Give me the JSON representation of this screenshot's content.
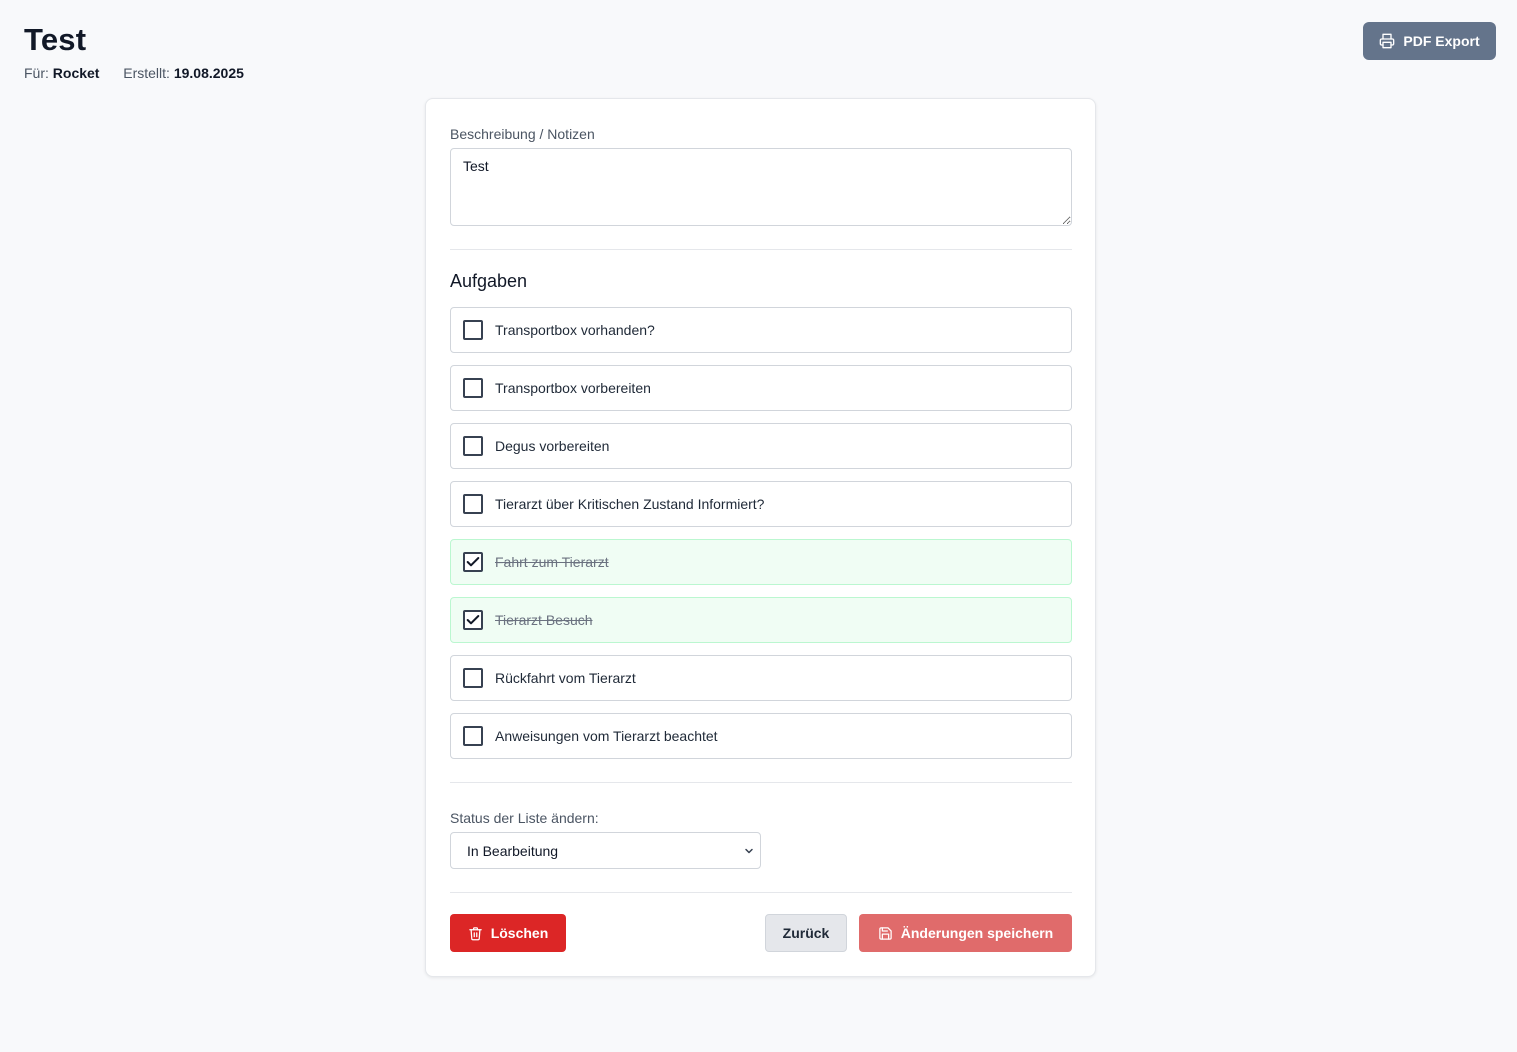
{
  "header": {
    "title": "Test",
    "for_label": "Für:",
    "for_value": "Rocket",
    "created_label": "Erstellt:",
    "created_value": "19.08.2025",
    "pdf_export_label": "PDF Export"
  },
  "notes": {
    "label": "Beschreibung / Notizen",
    "value": "Test"
  },
  "tasks": {
    "title": "Aufgaben",
    "items": [
      {
        "label": "Transportbox vorhanden?",
        "done": false
      },
      {
        "label": "Transportbox vorbereiten",
        "done": false
      },
      {
        "label": "Degus vorbereiten",
        "done": false
      },
      {
        "label": "Tierarzt über Kritischen Zustand Informiert?",
        "done": false
      },
      {
        "label": "Fahrt zum Tierarzt",
        "done": true
      },
      {
        "label": "Tierarzt Besuch",
        "done": true
      },
      {
        "label": "Rückfahrt vom Tierarzt",
        "done": false
      },
      {
        "label": "Anweisungen vom Tierarzt beachtet",
        "done": false
      }
    ]
  },
  "status": {
    "label": "Status der Liste ändern:",
    "selected": "In Bearbeitung"
  },
  "actions": {
    "delete_label": "Löschen",
    "back_label": "Zurück",
    "save_label": "Änderungen speichern"
  },
  "icons": {
    "pdf_export": "printer-icon",
    "delete": "trash-icon",
    "save": "save-icon",
    "select": "chevron-down-icon",
    "task_done": "check-icon"
  },
  "colors": {
    "background": "#f8f9fb",
    "pdf_button": "#64748b",
    "delete_button": "#dc2626",
    "save_button": "#e06b6b",
    "back_button": "#e5e7eb",
    "done_task_bg": "#f0fdf4",
    "done_task_border": "#bbf7d0"
  }
}
